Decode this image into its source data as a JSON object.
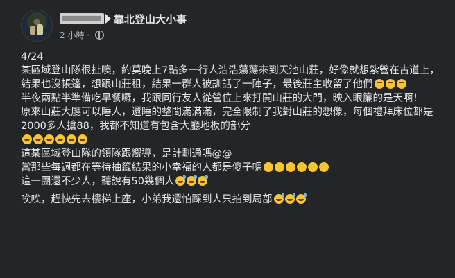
{
  "post": {
    "group_name": "靠北登山大小事",
    "timestamp": "2 小時",
    "date_line": "4/24",
    "paragraph1": "某區域登山隊很扯噢，約莫晚上7點多一行人浩浩蕩蕩來到天池山莊，好像就想紮營在古道上，結果也沒帳篷，想跟山莊租，結果一群人被訓話了一陣子，最後莊主收留了他們",
    "paragraph2": "半夜兩點半準備吃早餐囉，我跟同行友人從營位上來打開山莊的大門，映入眼簾的是天啊！",
    "paragraph3": "原來山莊大廳可以睡人，還睡的整間滿滿滿，完全限制了我對山莊的想像，每個禮拜床位都是2000多人搶88，我都不知道有包含大廳地板的部分",
    "paragraph4": "這某區域登山隊的領隊跟嚮導，是計劃通嗎@@",
    "paragraph5": "當那些每週都在等待抽籤結果的小幸福的人都是傻子嗎",
    "paragraph6": "這一團還不少人，聽說有50幾個人",
    "paragraph7": "唉唉，趕快先去樓梯上座，小弟我還怕踩到人只拍到局部"
  },
  "icons": {
    "avatar": "avatar",
    "arrow": "triangle-right-icon",
    "privacy": "globe-icon",
    "emoji_sleep": "sleepy-face-emoji",
    "emoji_laugh": "rolling-laughing-emoji",
    "emoji_sweat": "grinning-sweat-emoji"
  },
  "colors": {
    "background": "#242526",
    "text": "#e4e6eb",
    "meta": "#b0b3b8",
    "emoji": "#f6c531"
  }
}
